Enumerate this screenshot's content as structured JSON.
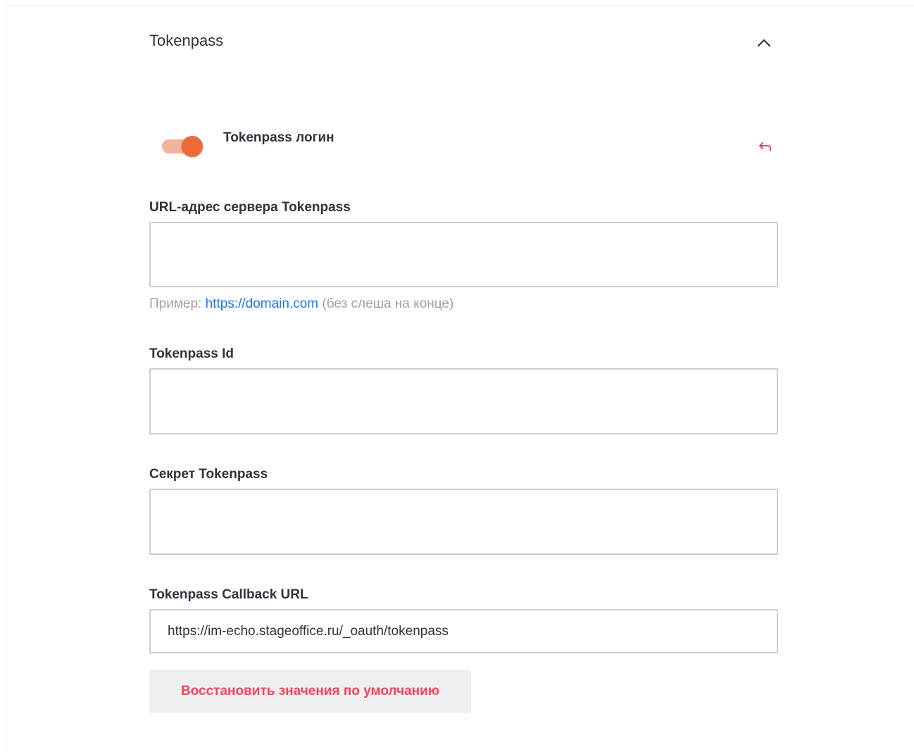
{
  "section": {
    "title": "Tokenpass",
    "collapse_icon": "chevron-up-icon"
  },
  "toggle": {
    "label": "Tokenpass логин",
    "state": "on",
    "reset_icon": "undo-arrow-icon",
    "colors": {
      "track": "#f5b29c",
      "knob": "#ec6b38",
      "reset_icon": "#f5455c"
    }
  },
  "fields": {
    "server_url": {
      "label": "URL-адрес сервера Tokenpass",
      "value": "",
      "hint_prefix": "Пример:",
      "hint_link": "https://domain.com",
      "hint_suffix": "(без слеша на конце)"
    },
    "tokenpass_id": {
      "label": "Tokenpass Id",
      "value": ""
    },
    "secret": {
      "label": "Секрет Tokenpass",
      "value": ""
    },
    "callback_url": {
      "label": "Tokenpass Callback URL",
      "value": "https://im-echo.stageoffice.ru/_oauth/tokenpass"
    }
  },
  "actions": {
    "restore_defaults_label": "Восстановить значения по умолчанию",
    "restore_color": "#f5455c"
  }
}
